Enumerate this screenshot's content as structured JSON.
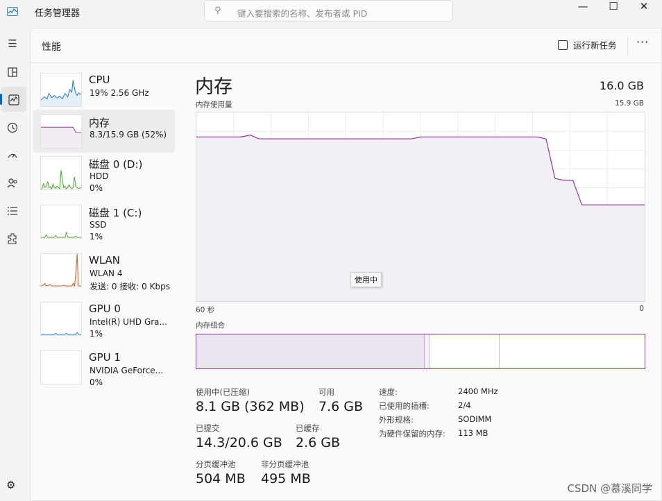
{
  "app": {
    "title": "任务管理器"
  },
  "search": {
    "placeholder": "键入要搜索的名称、发布者或 PID",
    "icon": "search-icon"
  },
  "window_controls": {
    "minimize": "—",
    "maximize": "☐",
    "close": "✕"
  },
  "nav": {
    "icons": [
      "hamburger-icon",
      "processes-icon",
      "performance-icon",
      "app-history-icon",
      "startup-icon",
      "users-icon",
      "details-icon",
      "services-icon"
    ],
    "settings_icon": "gear-icon"
  },
  "page": {
    "title": "性能",
    "run_new_task": "运行新任务",
    "more": "···"
  },
  "devices": [
    {
      "name": "CPU",
      "line2": "19% 2.56 GHz",
      "line3": "",
      "color": "#2b7dc0"
    },
    {
      "name": "内存",
      "line2": "8.3/15.9 GB (52%)",
      "line3": "",
      "color": "#8e34a4"
    },
    {
      "name": "磁盘 0 (D:)",
      "line2": "HDD",
      "line3": "0%",
      "color": "#4ca42a"
    },
    {
      "name": "磁盘 1 (C:)",
      "line2": "SSD",
      "line3": "1%",
      "color": "#4ca42a"
    },
    {
      "name": "WLAN",
      "line2": "WLAN 4",
      "line3": "发送: 0 接收: 0 Kbps",
      "color": "#c0622b"
    },
    {
      "name": "GPU 0",
      "line2": "Intel(R) UHD Gra...",
      "line3": "1%",
      "color": "#2b7dc0"
    },
    {
      "name": "GPU 1",
      "line2": "NVIDIA GeForce...",
      "line3": "0%",
      "color": "#2b7dc0"
    }
  ],
  "memory": {
    "title": "内存",
    "total": "16.0 GB",
    "usage_label": "内存使用量",
    "usage_max": "15.9 GB",
    "time_left": "60 秒",
    "time_right": "0",
    "tooltip": "使用中",
    "composition_label": "内存组合",
    "composition": {
      "in_use": 0.51,
      "modified": 0.012,
      "standby": 0.155,
      "free": 0.323
    },
    "usage_history": [
      87,
      87,
      87,
      87,
      87,
      87,
      88,
      86,
      86,
      86,
      86,
      86,
      86,
      86,
      86,
      86,
      86,
      86,
      86,
      86,
      86,
      86,
      86,
      86,
      86,
      87,
      87,
      87,
      87,
      87,
      87,
      87,
      87,
      87,
      87,
      87,
      87,
      87,
      87,
      86,
      65,
      64,
      64,
      51,
      51,
      51,
      51,
      51,
      51,
      51,
      51
    ],
    "stats": {
      "in_use_label": "使用中(已压缩)",
      "in_use_value": "8.1 GB (362 MB)",
      "available_label": "可用",
      "available_value": "7.6 GB",
      "committed_label": "已提交",
      "committed_value": "14.3/20.6 GB",
      "cached_label": "已缓存",
      "cached_value": "2.6 GB",
      "paged_label": "分页缓冲池",
      "paged_value": "504 MB",
      "nonpaged_label": "非分页缓冲池",
      "nonpaged_value": "495 MB"
    },
    "kv": [
      {
        "key": "速度:",
        "value": "2400 MHz"
      },
      {
        "key": "已使用的插槽:",
        "value": "2/4"
      },
      {
        "key": "外形规格:",
        "value": "SODIMM"
      },
      {
        "key": "为硬件保留的内存:",
        "value": "113 MB"
      }
    ]
  },
  "watermark": "CSDN @慕溪同学",
  "colors": {
    "memory": "#8e34a4",
    "memory_fill": "#f1edf3",
    "accent": "#0067c0"
  }
}
